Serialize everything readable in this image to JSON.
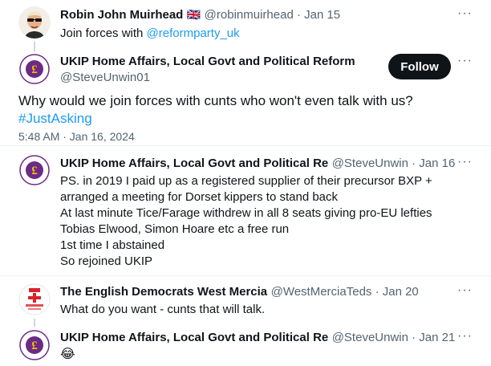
{
  "tweets": {
    "reply1": {
      "author_name": "Robin John Muirhead",
      "flag": "🇬🇧",
      "handle_date": "@robinmuirhead · Jan 15",
      "text_prefix": "Join forces with ",
      "mention": "@reformparty_uk"
    },
    "main": {
      "author_name": "UKIP Home Affairs, Local Govt and Political Reform",
      "handle": "@SteveUnwin01",
      "follow_label": "Follow",
      "text": "Why would we join forces with cunts who won't even talk with us?",
      "hashtag": "#JustAsking",
      "timestamp": "5:48 AM · Jan 16, 2024"
    },
    "reply2": {
      "author_name": "UKIP Home Affairs, Local Govt and Political Re",
      "handle_date": "@SteveUnwin · Jan 16",
      "lines": [
        "PS. in 2019 I paid up as a registered supplier of their precursor BXP +",
        "arranged a meeting for Dorset kippers to stand back",
        "At last minute Tice/Farage withdrew in all 8 seats giving pro-EU lefties",
        "Tobias Elwood, Simon Hoare etc a free run",
        "1st time I abstained",
        "So rejoined UKIP"
      ]
    },
    "reply3": {
      "author_name": "The English Democrats West Mercia",
      "handle_date": "@WestMerciaTeds · Jan 20",
      "text": "What do you want - cunts that will talk."
    },
    "reply4": {
      "author_name": "UKIP Home Affairs, Local Govt and Political Re",
      "handle_date": "@SteveUnwin · Jan 21",
      "text": "😂"
    },
    "more_glyph": "···"
  },
  "colors": {
    "link": "#1d9bf0",
    "muted": "#536471",
    "ukip_purple": "#6c2a86",
    "ukip_gold": "#f2c200"
  },
  "icons": [
    "more-icon",
    "ukip-logo-avatar",
    "english-democrats-avatar",
    "robin-avatar"
  ]
}
